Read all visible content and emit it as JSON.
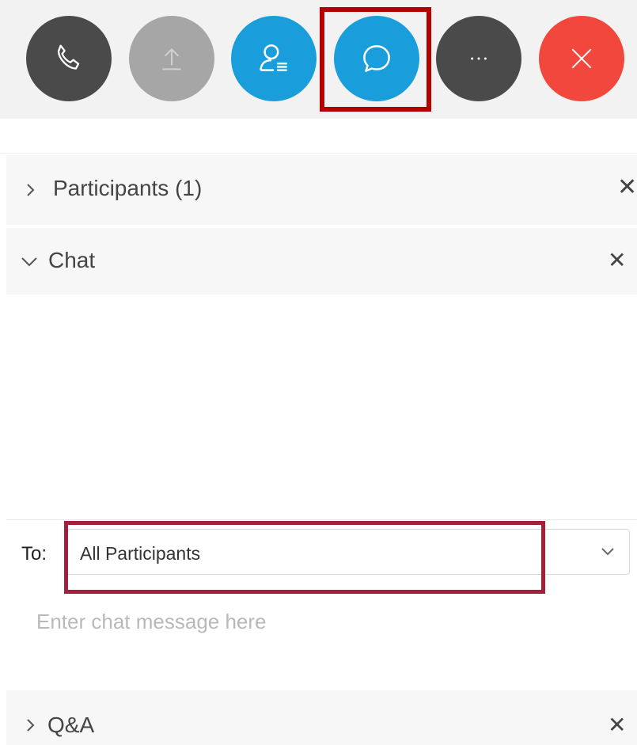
{
  "toolbar": {
    "buttons": [
      {
        "name": "audio",
        "icon": "phone-icon",
        "color": "#4a4a4a"
      },
      {
        "name": "share",
        "icon": "upload-icon",
        "color": "#a6a6a6"
      },
      {
        "name": "participants",
        "icon": "person-list-icon",
        "color": "#1a9ddb"
      },
      {
        "name": "chat",
        "icon": "chat-bubble-icon",
        "color": "#1a9ddb"
      },
      {
        "name": "more",
        "icon": "ellipsis-icon",
        "color": "#4a4a4a"
      },
      {
        "name": "leave",
        "icon": "close-icon",
        "color": "#f1473c"
      }
    ],
    "highlight_color": "#b30000"
  },
  "panels": {
    "participants": {
      "label": "Participants (1)",
      "expanded": false
    },
    "chat": {
      "label": "Chat",
      "expanded": true
    },
    "qa": {
      "label": "Q&A",
      "expanded": false
    }
  },
  "chat": {
    "to_label": "To:",
    "recipient": "All Participants",
    "message_placeholder": "Enter chat message here",
    "highlight_color": "#a3203a"
  }
}
